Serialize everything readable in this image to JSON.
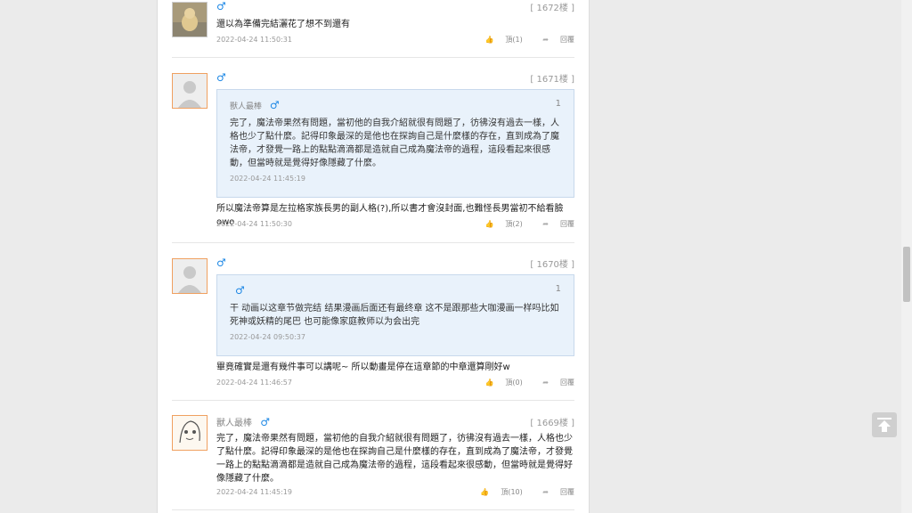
{
  "icons": {
    "male": "male-symbol-icon",
    "like": "thumbs-up-icon",
    "reply": "reply-arrow-icon",
    "top": "back-to-top-icon"
  },
  "colors": {
    "male": "#1e88e5",
    "quote_bg": "#e9f2fb",
    "avatar_border": "#f0a060"
  },
  "posts": [
    {
      "floor": "[ 1672楼 ]",
      "text": "還以為準備完結灑花了想不到還有",
      "time": "2022-04-24 11:50:31",
      "like": "頂(1)",
      "reply": "回覆"
    },
    {
      "floor": "[ 1671楼 ]",
      "quote": {
        "user": "獸人最棒",
        "index": "1",
        "text": "完了，魔法帝果然有問題，當初他的自我介紹就很有問題了，彷彿沒有過去一樣，人格也少了點什麼。記得印象最深的是他也在探詢自己是什麼樣的存在，直到成為了魔法帝，才發覺一路上的點點滴滴都是造就自己成為魔法帝的過程，這段看起來很感動，但當時就是覺得好像隱藏了什麼。",
        "time": "2022-04-24 11:45:19"
      },
      "text": "所以魔法帝算是左拉格家族長男的副人格(?),所以書才會沒封面,也難怪長男當初不給看臉owo",
      "time": "2022-04-24 11:50:30",
      "like": "頂(2)",
      "reply": "回覆"
    },
    {
      "floor": "[ 1670楼 ]",
      "quote": {
        "user": "",
        "index": "1",
        "text": "干 动画以这章节做完结 结果漫画后面还有最终章 这不是跟那些大咖漫画一样吗比如死神或妖精的尾巴 也可能像家庭教师以为会出完",
        "time": "2022-04-24 09:50:37"
      },
      "text": "畢竟確實是還有幾件事可以講呢~ 所以動畫是停在這章節的中章還算剛好w",
      "time": "2022-04-24 11:46:57",
      "like": "頂(0)",
      "reply": "回覆"
    },
    {
      "floor": "[ 1669楼 ]",
      "user": "獸人最棒",
      "text": "完了，魔法帝果然有問題，當初他的自我介紹就很有問題了，彷彿沒有過去一樣，人格也少了點什麼。記得印象最深的是他也在探詢自己是什麼樣的存在，直到成為了魔法帝，才發覺一路上的點點滴滴都是造就自己成為魔法帝的過程，這段看起來很感動，但當時就是覺得好像隱藏了什麼。",
      "time": "2022-04-24 11:45:19",
      "like": "頂(10)",
      "reply": "回覆"
    }
  ]
}
